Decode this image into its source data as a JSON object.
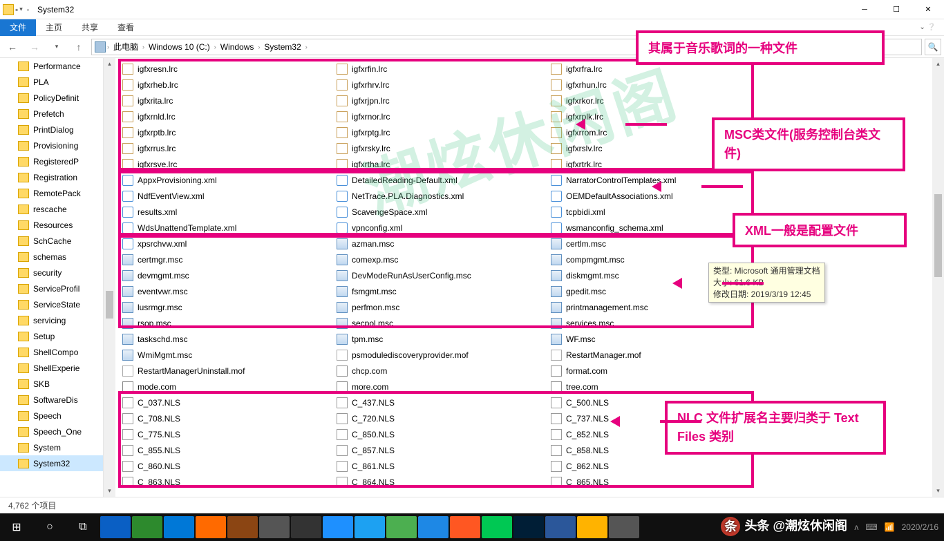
{
  "window": {
    "title": "System32"
  },
  "ribbon": {
    "file": "文件",
    "tabs": [
      "主页",
      "共享",
      "查看"
    ]
  },
  "breadcrumbs": [
    "此电脑",
    "Windows 10 (C:)",
    "Windows",
    "System32"
  ],
  "sidebar": [
    {
      "label": "Performance"
    },
    {
      "label": "PLA"
    },
    {
      "label": "PolicyDefinit"
    },
    {
      "label": "Prefetch"
    },
    {
      "label": "PrintDialog"
    },
    {
      "label": "Provisioning"
    },
    {
      "label": "RegisteredP"
    },
    {
      "label": "Registration"
    },
    {
      "label": "RemotePack"
    },
    {
      "label": "rescache"
    },
    {
      "label": "Resources"
    },
    {
      "label": "SchCache"
    },
    {
      "label": "schemas"
    },
    {
      "label": "security"
    },
    {
      "label": "ServiceProfil"
    },
    {
      "label": "ServiceState"
    },
    {
      "label": "servicing"
    },
    {
      "label": "Setup"
    },
    {
      "label": "ShellCompo"
    },
    {
      "label": "ShellExperie"
    },
    {
      "label": "SKB"
    },
    {
      "label": "SoftwareDis"
    },
    {
      "label": "Speech"
    },
    {
      "label": "Speech_One"
    },
    {
      "label": "System"
    },
    {
      "label": "System32",
      "sel": true
    }
  ],
  "files": [
    {
      "n": "igfxresn.lrc",
      "t": "lrc"
    },
    {
      "n": "igfxrfin.lrc",
      "t": "lrc"
    },
    {
      "n": "igfxrfra.lrc",
      "t": "lrc"
    },
    {
      "n": "igfxrheb.lrc",
      "t": "lrc"
    },
    {
      "n": "igfxrhrv.lrc",
      "t": "lrc"
    },
    {
      "n": "igfxrhun.lrc",
      "t": "lrc"
    },
    {
      "n": "igfxrita.lrc",
      "t": "lrc"
    },
    {
      "n": "igfxrjpn.lrc",
      "t": "lrc"
    },
    {
      "n": "igfxrkor.lrc",
      "t": "lrc"
    },
    {
      "n": "igfxrnld.lrc",
      "t": "lrc"
    },
    {
      "n": "igfxrnor.lrc",
      "t": "lrc"
    },
    {
      "n": "igfxrplk.lrc",
      "t": "lrc"
    },
    {
      "n": "igfxrptb.lrc",
      "t": "lrc"
    },
    {
      "n": "igfxrptg.lrc",
      "t": "lrc"
    },
    {
      "n": "igfxrrom.lrc",
      "t": "lrc"
    },
    {
      "n": "igfxrrus.lrc",
      "t": "lrc"
    },
    {
      "n": "igfxrsky.lrc",
      "t": "lrc"
    },
    {
      "n": "igfxrslv.lrc",
      "t": "lrc"
    },
    {
      "n": "igfxrsve.lrc",
      "t": "lrc"
    },
    {
      "n": "igfxrtha.lrc",
      "t": "lrc"
    },
    {
      "n": "igfxrtrk.lrc",
      "t": "lrc"
    },
    {
      "n": "AppxProvisioning.xml",
      "t": "xml"
    },
    {
      "n": "DetailedReading-Default.xml",
      "t": "xml"
    },
    {
      "n": "NarratorControlTemplates.xml",
      "t": "xml"
    },
    {
      "n": "NdfEventView.xml",
      "t": "xml"
    },
    {
      "n": "NetTrace.PLA.Diagnostics.xml",
      "t": "xml"
    },
    {
      "n": "OEMDefaultAssociations.xml",
      "t": "xml"
    },
    {
      "n": "results.xml",
      "t": "xml"
    },
    {
      "n": "ScavengeSpace.xml",
      "t": "xml"
    },
    {
      "n": "tcpbidi.xml",
      "t": "xml"
    },
    {
      "n": "WdsUnattendTemplate.xml",
      "t": "xml"
    },
    {
      "n": "vpnconfig.xml",
      "t": "xml"
    },
    {
      "n": "wsmanconfig_schema.xml",
      "t": "xml"
    },
    {
      "n": "xpsrchvw.xml",
      "t": "xml"
    },
    {
      "n": "azman.msc",
      "t": "msc"
    },
    {
      "n": "certlm.msc",
      "t": "msc"
    },
    {
      "n": "certmgr.msc",
      "t": "msc"
    },
    {
      "n": "comexp.msc",
      "t": "msc"
    },
    {
      "n": "compmgmt.msc",
      "t": "msc"
    },
    {
      "n": "devmgmt.msc",
      "t": "msc"
    },
    {
      "n": "DevModeRunAsUserConfig.msc",
      "t": "msc"
    },
    {
      "n": "diskmgmt.msc",
      "t": "msc"
    },
    {
      "n": "eventvwr.msc",
      "t": "msc"
    },
    {
      "n": "fsmgmt.msc",
      "t": "msc"
    },
    {
      "n": "gpedit.msc",
      "t": "msc"
    },
    {
      "n": "lusrmgr.msc",
      "t": "msc"
    },
    {
      "n": "perfmon.msc",
      "t": "msc"
    },
    {
      "n": "printmanagement.msc",
      "t": "msc"
    },
    {
      "n": "rsop.msc",
      "t": "msc"
    },
    {
      "n": "secpol.msc",
      "t": "msc"
    },
    {
      "n": "services.msc",
      "t": "msc"
    },
    {
      "n": "taskschd.msc",
      "t": "msc"
    },
    {
      "n": "tpm.msc",
      "t": "msc"
    },
    {
      "n": "WF.msc",
      "t": "msc"
    },
    {
      "n": "WmiMgmt.msc",
      "t": "msc"
    },
    {
      "n": "psmodulediscoveryprovider.mof",
      "t": "mof"
    },
    {
      "n": "RestartManager.mof",
      "t": "mof"
    },
    {
      "n": "RestartManagerUninstall.mof",
      "t": "mof"
    },
    {
      "n": "chcp.com",
      "t": "com"
    },
    {
      "n": "format.com",
      "t": "com"
    },
    {
      "n": "mode.com",
      "t": "com"
    },
    {
      "n": "more.com",
      "t": "com"
    },
    {
      "n": "tree.com",
      "t": "com"
    },
    {
      "n": "C_037.NLS",
      "t": "nls"
    },
    {
      "n": "C_437.NLS",
      "t": "nls"
    },
    {
      "n": "C_500.NLS",
      "t": "nls"
    },
    {
      "n": "C_708.NLS",
      "t": "nls"
    },
    {
      "n": "C_720.NLS",
      "t": "nls"
    },
    {
      "n": "C_737.NLS",
      "t": "nls"
    },
    {
      "n": "C_775.NLS",
      "t": "nls"
    },
    {
      "n": "C_850.NLS",
      "t": "nls"
    },
    {
      "n": "C_852.NLS",
      "t": "nls"
    },
    {
      "n": "C_855.NLS",
      "t": "nls"
    },
    {
      "n": "C_857.NLS",
      "t": "nls"
    },
    {
      "n": "C_858.NLS",
      "t": "nls"
    },
    {
      "n": "C_860.NLS",
      "t": "nls"
    },
    {
      "n": "C_861.NLS",
      "t": "nls"
    },
    {
      "n": "C_862.NLS",
      "t": "nls"
    },
    {
      "n": "C_863.NLS",
      "t": "nls"
    },
    {
      "n": "C_864.NLS",
      "t": "nls"
    },
    {
      "n": "C_865.NLS",
      "t": "nls"
    }
  ],
  "annotations": {
    "lrc": "其属于音乐歌词的一种文件",
    "msc": "MSC类文件(服务控制台类文件)",
    "xml": "XML一般是配置文件",
    "nls": "NLC 文件扩展名主要归类于 Text Files 类别"
  },
  "tooltip": {
    "type": "类型: Microsoft 通用管理文档",
    "size": "大小: 61.6 KB",
    "date": "修改日期: 2019/3/19 12:45"
  },
  "status": "4,762 个项目",
  "watermark": "潮炫休闲阁",
  "brand": "头条 @潮炫休闲阁",
  "clock": "2020/2/16",
  "taskbar_apps": [
    {
      "c": "#0a5fc4"
    },
    {
      "c": "#2d8a2d"
    },
    {
      "c": "#0078d7"
    },
    {
      "c": "#ff6a00"
    },
    {
      "c": "#8b4513"
    },
    {
      "c": "#555"
    },
    {
      "c": "#333"
    },
    {
      "c": "#1e90ff"
    },
    {
      "c": "#1da1f2"
    },
    {
      "c": "#4caf50"
    },
    {
      "c": "#1e88e5"
    },
    {
      "c": "#ff5722"
    },
    {
      "c": "#00c853"
    },
    {
      "c": "#001e36"
    },
    {
      "c": "#2b579a"
    },
    {
      "c": "#ffb300"
    },
    {
      "c": "#555"
    }
  ]
}
